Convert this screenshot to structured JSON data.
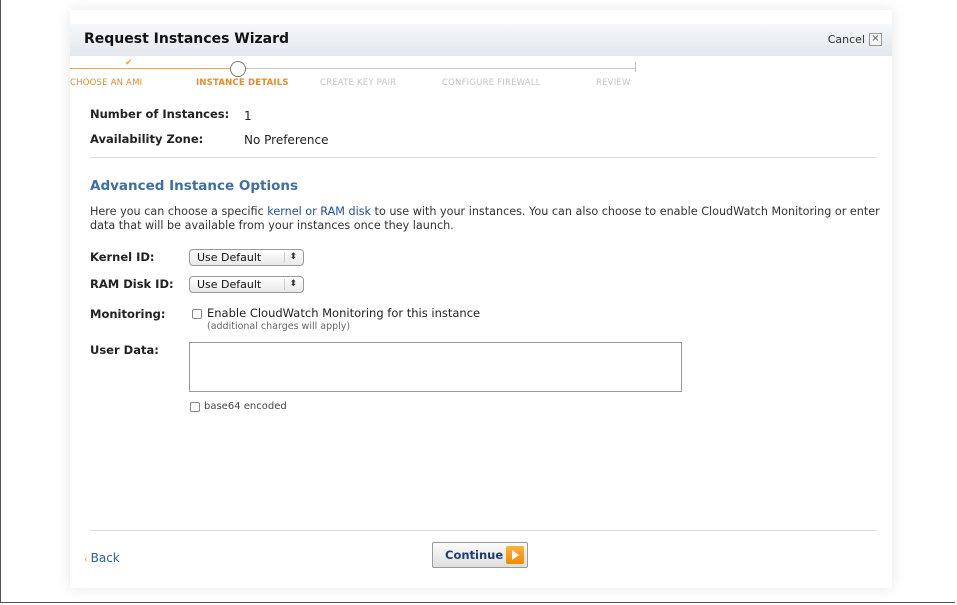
{
  "wizard": {
    "title": "Request Instances Wizard",
    "cancel_label": "Cancel"
  },
  "steps": [
    {
      "label": "CHOOSE AN AMI",
      "state": "done"
    },
    {
      "label": "INSTANCE DETAILS",
      "state": "active"
    },
    {
      "label": "CREATE KEY PAIR",
      "state": "pending"
    },
    {
      "label": "CONFIGURE FIREWALL",
      "state": "pending"
    },
    {
      "label": "REVIEW",
      "state": "pending"
    }
  ],
  "summary": {
    "instances_label": "Number of Instances:",
    "instances_value": "1",
    "zone_label": "Availability Zone:",
    "zone_value": "No Preference"
  },
  "advanced": {
    "title": "Advanced Instance Options",
    "desc_before": "Here you can choose a specific ",
    "desc_link": "kernel or RAM disk",
    "desc_after": " to use with your instances. You can also choose to enable CloudWatch Monitoring or enter data that will be available from your instances once they launch.",
    "kernel_label": "Kernel ID:",
    "kernel_value": "Use Default",
    "ramdisk_label": "RAM Disk ID:",
    "ramdisk_value": "Use Default",
    "monitoring_label": "Monitoring:",
    "monitoring_checkbox": "Enable CloudWatch Monitoring for this instance",
    "monitoring_note": "(additional charges will apply)",
    "monitoring_checked": false,
    "userdata_label": "User Data:",
    "userdata_value": "",
    "base64_label": "base64 encoded",
    "base64_checked": false
  },
  "footer": {
    "back_label": "Back",
    "continue_label": "Continue"
  },
  "colors": {
    "accent_orange": "#e58b2d",
    "section_blue": "#3f6ea4",
    "link_blue": "#1f4f9c"
  }
}
